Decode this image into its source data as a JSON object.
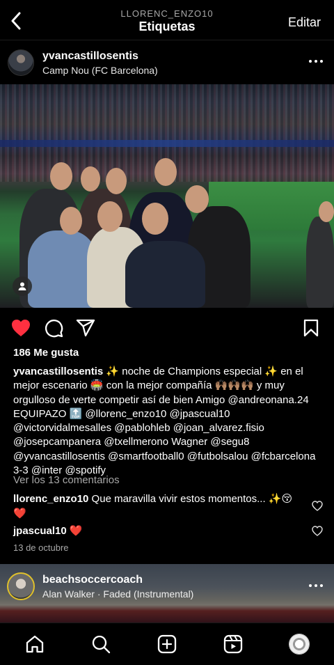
{
  "header": {
    "subtitle": "LLORENC_ENZO10",
    "title": "Etiquetas",
    "edit_label": "Editar"
  },
  "post": {
    "username": "yvancastillosentis",
    "location": "Camp Nou (FC Barcelona)",
    "likes": "186 Me gusta",
    "caption_user": "yvancastillosentis",
    "caption_text": " ✨ noche de Champions especial ✨ en el mejor escenario 🏟️ con la mejor compañía 🙌🏽🙌🏽🙌🏽 y muy orgulloso de verte competir así de bien Amigo @andreonana.24 EQUIPAZO 🔝 @llorenc_enzo10 @jpascual10 @victorvidalmesalles @pablohleb @joan_alvarez.fisio @josepcampanera @txellmerono Wagner @segu8 @yvancastillosentis @smartfootball0 @futbolsalou @fcbarcelona 3-3 @inter @spotify",
    "view_comments": "Ver los 13 comentarios",
    "comments": [
      {
        "user": "llorenc_enzo10",
        "text": " Que maravilla vivir estos momentos... ✨😚❤️"
      },
      {
        "user": "jpascual10",
        "text": " ❤️"
      }
    ],
    "date": "13 de octubre"
  },
  "next_post": {
    "username": "beachsoccercoach",
    "song": "Alan Walker · Faded (Instrumental)"
  },
  "colors": {
    "like_red": "#ff3040",
    "secondary_text": "#a8a8a8"
  },
  "icons": {
    "back": "chevron-left-icon",
    "like": "heart-filled-icon",
    "comment": "comment-bubble-icon",
    "share": "paper-plane-icon",
    "save": "bookmark-icon",
    "tag": "person-tag-icon",
    "nav": [
      "home-icon",
      "search-icon",
      "create-plus-icon",
      "reels-icon",
      "profile-avatar"
    ]
  }
}
